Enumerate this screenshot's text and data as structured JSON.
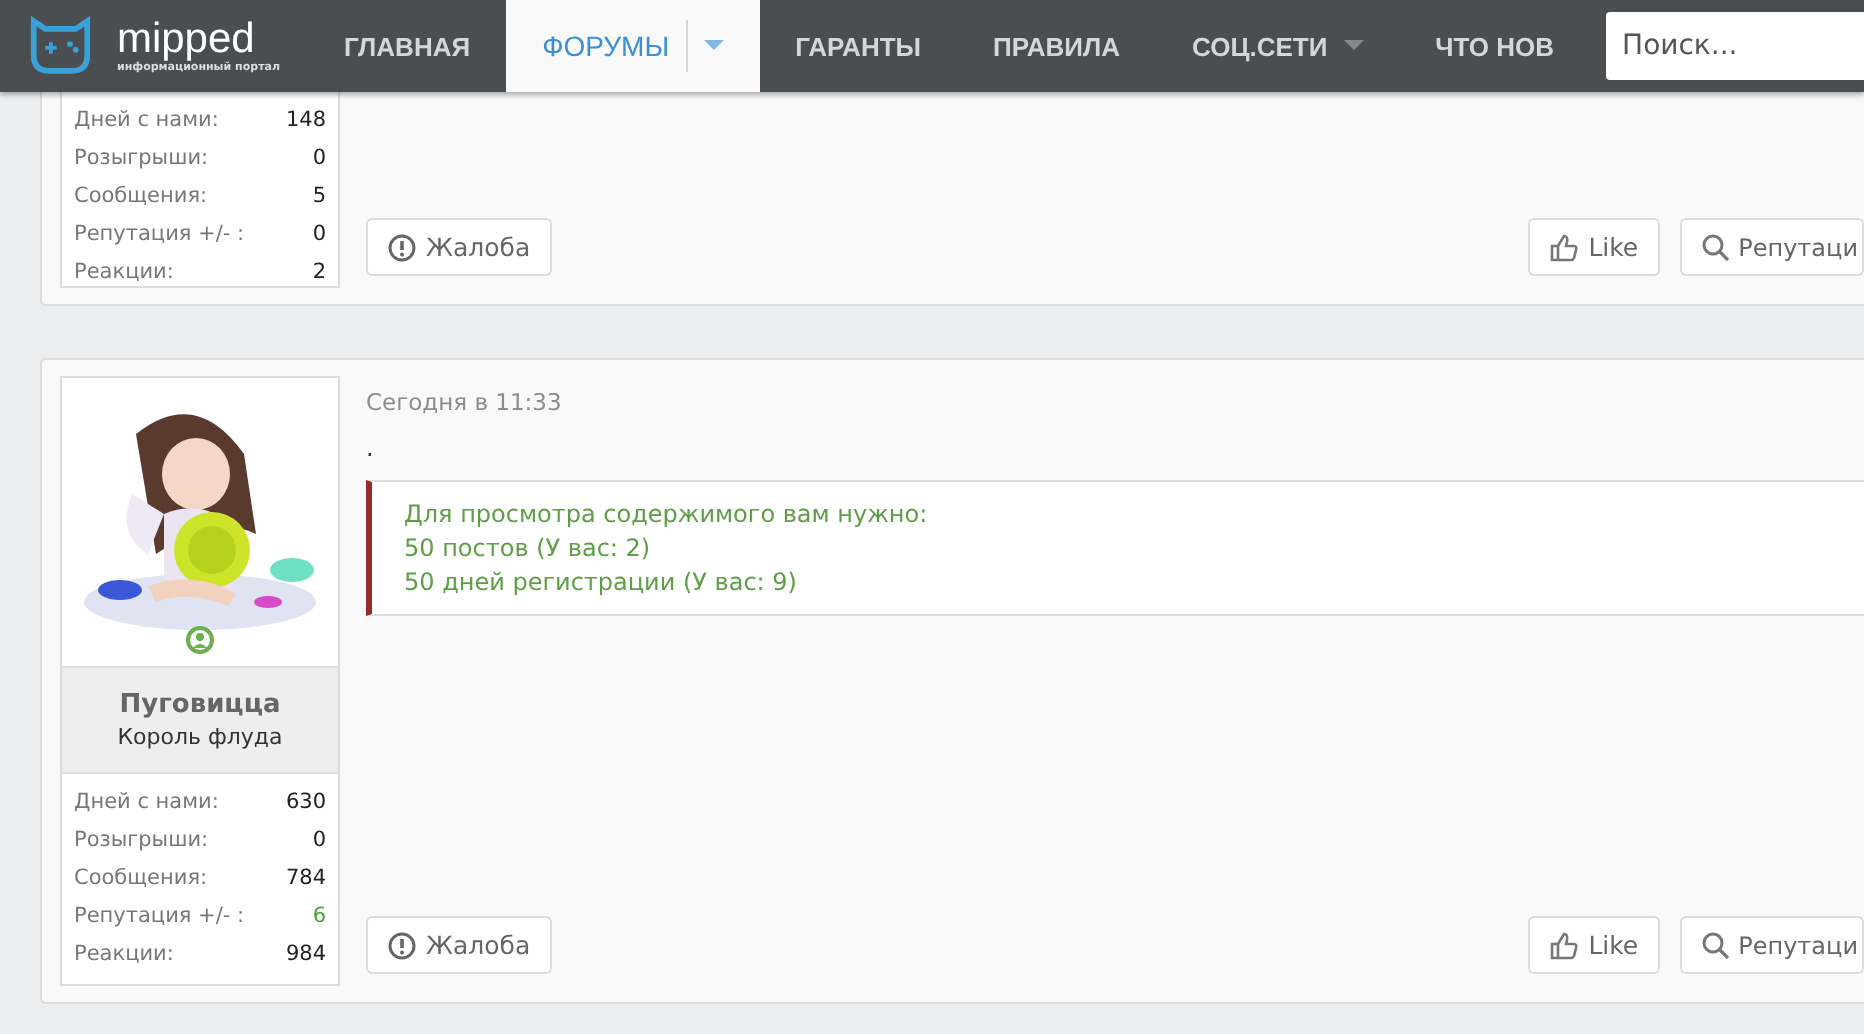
{
  "header": {
    "logo": {
      "name": "mipped",
      "tagline": "информационный портал"
    },
    "nav": [
      {
        "label": "ГЛАВНАЯ",
        "selected": false,
        "dropdown": false
      },
      {
        "label": "ФОРУМЫ",
        "selected": true,
        "dropdown": true
      },
      {
        "label": "ГАРАНТЫ",
        "selected": false,
        "dropdown": false
      },
      {
        "label": "ПРАВИЛА",
        "selected": false,
        "dropdown": false
      },
      {
        "label": "СОЦ.СЕТИ",
        "selected": false,
        "dropdown": true
      },
      {
        "label": "ЧТО НОВ",
        "selected": false,
        "dropdown": false
      }
    ],
    "search": {
      "placeholder": "Поиск..."
    }
  },
  "posts": [
    {
      "user": {
        "stats": [
          {
            "label": "Дней с нами:",
            "value": "148",
            "color": "#222222"
          },
          {
            "label": "Розыгрыши:",
            "value": "0",
            "color": "#222222"
          },
          {
            "label": "Сообщения:",
            "value": "5",
            "color": "#222222"
          },
          {
            "label": "Репутация +/- :",
            "value": "0",
            "color": "#222222"
          },
          {
            "label": "Реакции:",
            "value": "2",
            "color": "#222222"
          }
        ]
      },
      "actions": [
        {
          "label": "Жалоба",
          "kind": "report"
        },
        {
          "label": "Like",
          "kind": "like"
        },
        {
          "label": "Репутаци",
          "kind": "reputation"
        }
      ]
    },
    {
      "user": {
        "online": true,
        "name": "Пуговицца",
        "title": "Король флуда",
        "stats": [
          {
            "label": "Дней с нами:",
            "value": "630",
            "color": "#222222"
          },
          {
            "label": "Розыгрыши:",
            "value": "0",
            "color": "#222222"
          },
          {
            "label": "Сообщения:",
            "value": "784",
            "color": "#222222"
          },
          {
            "label": "Репутация +/- :",
            "value": "6",
            "color": "#4aa03c"
          },
          {
            "label": "Реакции:",
            "value": "984",
            "color": "#222222"
          }
        ]
      },
      "date": "Сегодня в 11:33",
      "body": ".",
      "hidden_notice": [
        "Для просмотра содержимого вам нужно:",
        "50 постов (У вас: 2)",
        "50 дней регистрации (У вас: 9)"
      ],
      "actions": [
        {
          "label": "Жалоба",
          "kind": "report"
        },
        {
          "label": "Like",
          "kind": "like"
        },
        {
          "label": "Репутаци",
          "kind": "reputation"
        }
      ]
    }
  ]
}
